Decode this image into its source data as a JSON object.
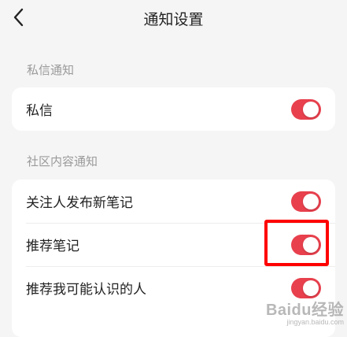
{
  "header": {
    "title": "通知设置",
    "back_icon": "chevron-left-icon"
  },
  "colors": {
    "toggle_on": "#e8404d",
    "highlight": "#ff0000",
    "background": "#f5f5f5"
  },
  "sections": [
    {
      "label": "私信通知",
      "items": [
        {
          "label": "私信",
          "enabled": true
        }
      ]
    },
    {
      "label": "社区内容通知",
      "items": [
        {
          "label": "关注人发布新笔记",
          "enabled": true
        },
        {
          "label": "推荐笔记",
          "enabled": true
        },
        {
          "label": "推荐我可能认识的人",
          "enabled": true
        }
      ]
    }
  ],
  "watermark": {
    "logo_text": "Baidu经验",
    "url_text": "jingyan.baidu.com"
  }
}
